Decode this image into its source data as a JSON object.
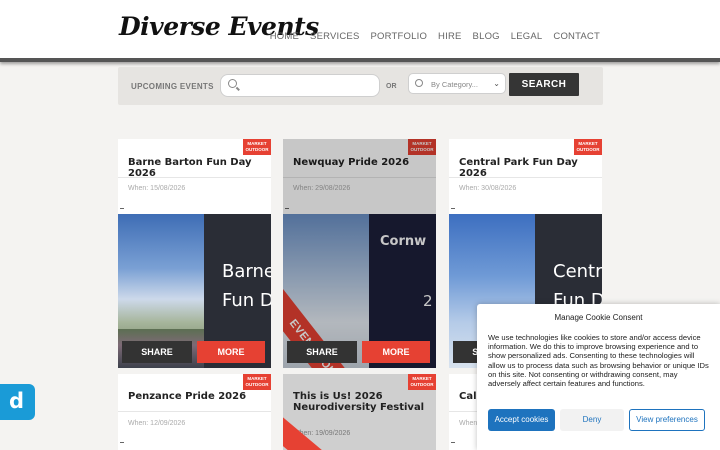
{
  "site": {
    "logo": "Diverse Events"
  },
  "nav": [
    "HOME",
    "SERVICES",
    "PORTFOLIO",
    "HIRE",
    "BLOG",
    "LEGAL",
    "CONTACT"
  ],
  "search": {
    "label": "UPCOMING EVENTS",
    "placeholder": "",
    "or_text": "OR",
    "category_placeholder": "By Category...",
    "button": "SEARCH"
  },
  "tag_text": "MARKET OUTDOOR",
  "events": [
    {
      "title": "Barne Barton Fun Day 2026",
      "when": "When: 15/08/2026",
      "banner": [
        "Barne",
        "Fun D"
      ],
      "sold_out": false
    },
    {
      "title": "Newquay Pride 2026",
      "when": "When: 29/08/2026",
      "banner": [
        "Cornw",
        "2"
      ],
      "sold_out": true,
      "sold_text": "EVENT SOLD OUT!"
    },
    {
      "title": "Central Park Fun Day 2026",
      "when": "When: 30/08/2026",
      "banner": [
        "Centr",
        "Fun D"
      ],
      "sold_out": false
    },
    {
      "title": "Penzance Pride 2026",
      "when": "When: 12/09/2026",
      "sold_out": false
    },
    {
      "title": "This is Us! 2026 Neurodiversity Festival",
      "when": "When: 19/09/2026",
      "sold_out": true
    },
    {
      "title": "Call",
      "when": "When",
      "sold_out": false
    }
  ],
  "actions": {
    "share": "SHARE",
    "more": "MORE"
  },
  "badge_icon": "d",
  "cookie": {
    "title": "Manage Cookie Consent",
    "body": "We use technologies like cookies to store and/or access device information. We do this to improve browsing experience and to show personalized ads. Consenting to these technologies will allow us to process data such as browsing behavior or unique IDs on this site. Not consenting or withdrawing consent, may adversely affect certain features and functions.",
    "accept": "Accept cookies",
    "deny": "Deny",
    "prefs": "View preferences"
  },
  "colors": {
    "accent": "#e64133",
    "dark": "#353535",
    "cookie_blue": "#1e73be",
    "badge": "#1a9bd7"
  }
}
